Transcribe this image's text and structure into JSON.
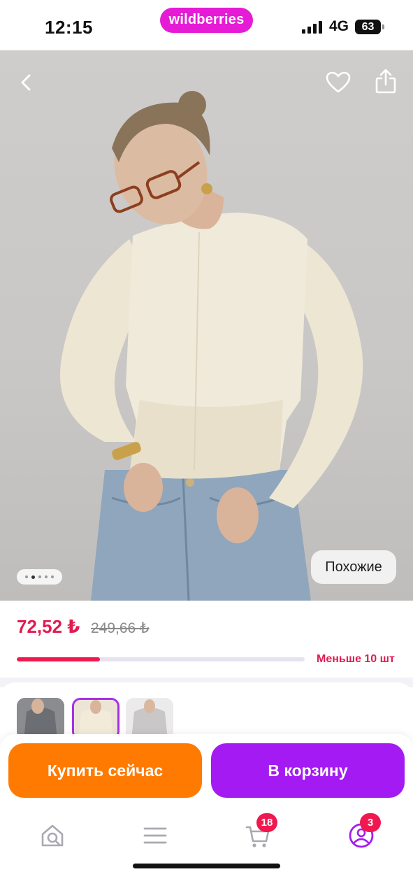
{
  "status_bar": {
    "time": "12:15",
    "brand": "wildberries",
    "network": "4G",
    "battery": "63"
  },
  "product": {
    "similar_label": "Похожие",
    "gallery": {
      "total": 5,
      "active": 2
    },
    "price_current": "72,52 ₺",
    "price_old": "249,66 ₺",
    "stock_label": "Меньше 10 шт",
    "stock_fraction": 0.29,
    "variants": [
      {
        "name": "grey",
        "selected": false
      },
      {
        "name": "cream",
        "selected": true
      },
      {
        "name": "light-grey",
        "selected": false
      }
    ]
  },
  "actions": {
    "buy_now": "Купить сейчас",
    "add_to_cart": "В корзину"
  },
  "nav": {
    "items": [
      {
        "icon": "home-search-icon"
      },
      {
        "icon": "menu-icon"
      },
      {
        "icon": "cart-icon",
        "badge": "18"
      },
      {
        "icon": "profile-icon",
        "badge": "3"
      }
    ]
  },
  "colors": {
    "brand": "#e51bd6",
    "price": "#e31a52",
    "buy_button": "#ff7a00",
    "cart_button": "#a31bf2",
    "badge": "#f0194f"
  }
}
